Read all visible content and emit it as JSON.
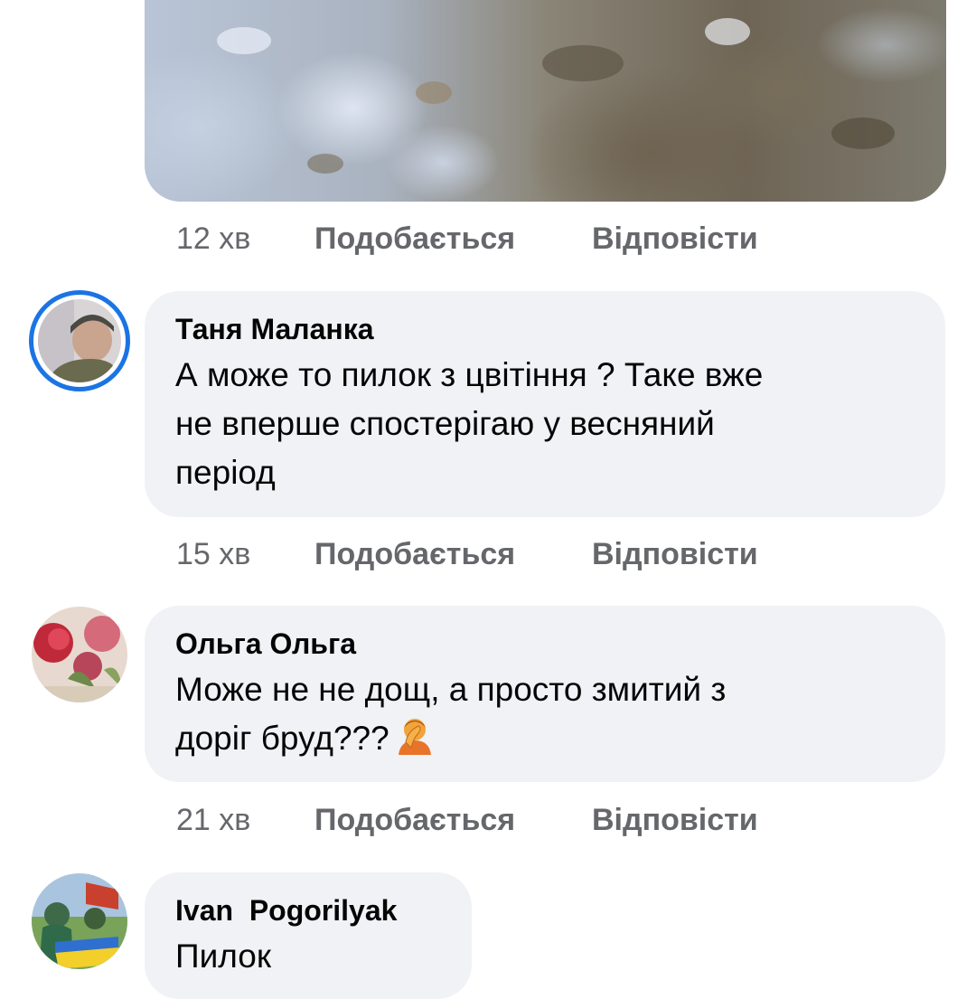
{
  "comments": [
    {
      "meta": {
        "time": "12 хв",
        "like": "Подобається",
        "reply": "Відповісти"
      }
    },
    {
      "author": "Таня Маланка",
      "text_lines": [
        "А може то пилок з цвітіння ? Таке вже",
        "не вперше спостерігаю у весняний",
        "період"
      ],
      "avatar_icon": "profile-photo-ring-icon",
      "meta": {
        "time": "15 хв",
        "like": "Подобається",
        "reply": "Відповісти"
      }
    },
    {
      "author": "Ольга Ольга",
      "text_lines": [
        "Може не не дощ, а  просто змитий з",
        "доріг бруд???"
      ],
      "emoji": "facepalm-emoji-icon",
      "avatar_icon": "flowers-profile-photo-icon",
      "meta": {
        "time": "21 хв",
        "like": "Подобається",
        "reply": "Відповісти"
      }
    },
    {
      "author": "Ivan  Pogorilyak",
      "text_lines": [
        "Пилок"
      ],
      "avatar_icon": "outdoor-profile-photo-icon"
    }
  ],
  "colors": {
    "accent_ring": "#1b74e4",
    "bubble": "#f0f2f5",
    "meta": "#65676b",
    "text": "#050505"
  }
}
